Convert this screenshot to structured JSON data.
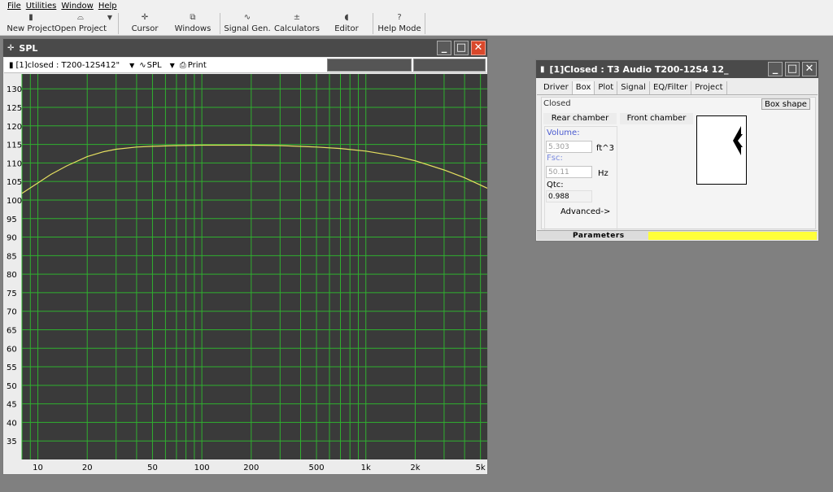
{
  "menu": [
    "File",
    "Utilities",
    "Window",
    "Help"
  ],
  "toolbar": [
    {
      "label": "New Project",
      "icon": "new-project-icon",
      "glyph": "▮"
    },
    {
      "label": "Open Project",
      "icon": "open-project-icon",
      "glyph": "⌓"
    },
    {
      "label": "Cursor",
      "icon": "cursor-icon",
      "glyph": "✛"
    },
    {
      "label": "Windows",
      "icon": "windows-icon",
      "glyph": "⧉"
    },
    {
      "label": "Signal Gen.",
      "icon": "signal-gen-icon",
      "glyph": "∿"
    },
    {
      "label": "Calculators",
      "icon": "calculators-icon",
      "glyph": "±"
    },
    {
      "label": "Editor",
      "icon": "editor-icon",
      "glyph": "◖"
    },
    {
      "label": "Help Mode",
      "icon": "help-icon",
      "glyph": "?"
    }
  ],
  "spl_window": {
    "title": "SPL",
    "project_select": "[1]closed : T200-12S412\"",
    "plot_select": "SPL",
    "print_label": "Print"
  },
  "box_window": {
    "title": "[1]Closed : T3 Audio T200-12S4 12_",
    "tabs": [
      "Driver",
      "Box",
      "Plot",
      "Signal",
      "EQ/Filter",
      "Project"
    ],
    "active_tab": "Box",
    "box_type": "Closed",
    "box_shape_button": "Box shape",
    "rear_chamber": "Rear chamber",
    "front_chamber": "Front chamber",
    "volume_label": "Volume:",
    "volume_value": "5.303",
    "volume_unit": "ft^3",
    "fsc_label": "Fsc:",
    "fsc_value": "50.11",
    "fsc_unit": "Hz",
    "qtc_label": "Qtc:",
    "qtc_value": "0.988",
    "advanced": "Advanced->",
    "status_text": "Parameters"
  },
  "colors": {
    "grid": "#2fb02f",
    "curve": "#e6e060",
    "plot_bg": "#3a3a3a"
  },
  "chart_data": {
    "type": "line",
    "x_scale": "log",
    "xlim": [
      8,
      5500
    ],
    "ylim": [
      30,
      134
    ],
    "y_ticks": [
      130,
      125,
      120,
      115,
      110,
      105,
      100,
      95,
      90,
      85,
      80,
      75,
      70,
      65,
      60,
      55,
      50,
      45,
      40,
      35
    ],
    "x_tick_labels": [
      {
        "value": 10,
        "label": "10"
      },
      {
        "value": 20,
        "label": "20"
      },
      {
        "value": 50,
        "label": "50"
      },
      {
        "value": 100,
        "label": "100"
      },
      {
        "value": 200,
        "label": "200"
      },
      {
        "value": 500,
        "label": "500"
      },
      {
        "value": 1000,
        "label": "1k"
      },
      {
        "value": 2000,
        "label": "2k"
      },
      {
        "value": 5000,
        "label": "5k"
      }
    ],
    "series": [
      {
        "color": "#e6e060",
        "x": [
          8,
          10,
          12,
          15,
          20,
          25,
          30,
          40,
          50,
          70,
          100,
          150,
          200,
          300,
          500,
          700,
          1000,
          1500,
          2000,
          3000,
          4000,
          5500
        ],
        "y": [
          101.8,
          104.6,
          106.9,
          109.2,
          111.7,
          113.0,
          113.7,
          114.3,
          114.5,
          114.7,
          114.8,
          114.8,
          114.8,
          114.7,
          114.3,
          113.9,
          113.2,
          111.9,
          110.6,
          108.1,
          106.0,
          103.2
        ]
      }
    ]
  }
}
